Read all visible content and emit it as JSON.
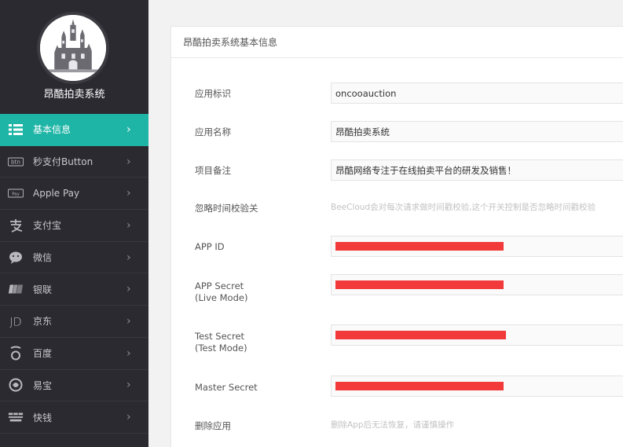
{
  "brand": {
    "name": "昂酷拍卖系统"
  },
  "nav": [
    {
      "icon": "list-icon",
      "label": "基本信息",
      "active": true
    },
    {
      "icon": "btn-icon",
      "label": "秒支付Button",
      "active": false
    },
    {
      "icon": "apple-pay-icon",
      "label": "Apple Pay",
      "active": false
    },
    {
      "icon": "alipay-icon",
      "label": "支付宝",
      "active": false
    },
    {
      "icon": "wechat-icon",
      "label": "微信",
      "active": false
    },
    {
      "icon": "unionpay-icon",
      "label": "银联",
      "active": false
    },
    {
      "icon": "jd-icon",
      "label": "京东",
      "active": false
    },
    {
      "icon": "baidu-icon",
      "label": "百度",
      "active": false
    },
    {
      "icon": "yeepay-icon",
      "label": "易宝",
      "active": false
    },
    {
      "icon": "kuaiqian-icon",
      "label": "快钱",
      "active": false
    }
  ],
  "panel": {
    "title": "昂酷拍卖系统基本信息",
    "fields": {
      "app_id_label": "应用标识",
      "app_id_value": "oncooauction",
      "app_name_label": "应用名称",
      "app_name_value": "昂酷拍卖系统",
      "remark_label": "项目备注",
      "remark_value": "昂酷网络专注于在线拍卖平台的研发及销售！",
      "ignore_ts_label": "忽略时间校验关",
      "ignore_ts_hint": "BeeCloud会对每次请求做时间戳校验,这个开关控制是否忽略时间戳校验",
      "appid_label": "APP ID",
      "app_secret_label_1": "APP Secret",
      "app_secret_label_2": "(Live Mode)",
      "test_secret_label_1": "Test Secret",
      "test_secret_label_2": "(Test Mode)",
      "master_secret_label": "Master Secret",
      "delete_label": "删除应用",
      "delete_hint": "删除App后无法恢复，请谨慎操作"
    }
  },
  "colors": {
    "sidebar": "#2b2a30",
    "active": "#1fb5a6",
    "redaction": "#f23a3a"
  }
}
